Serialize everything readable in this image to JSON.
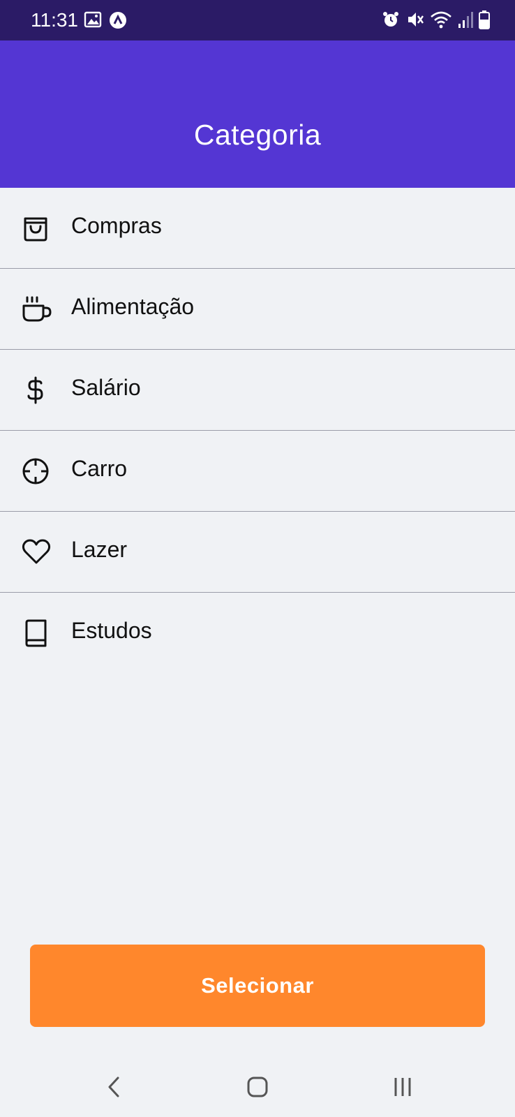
{
  "status_bar": {
    "time": "11:31",
    "left_icons": [
      "image-icon",
      "app-notification-icon"
    ],
    "right_icons": [
      "alarm-icon",
      "mute-icon",
      "wifi-icon",
      "signal-icon",
      "battery-icon"
    ]
  },
  "header": {
    "title": "Categoria",
    "background": "#5436D3"
  },
  "categories": [
    {
      "label": "Compras",
      "icon": "shopping-bag-icon"
    },
    {
      "label": "Alimentação",
      "icon": "coffee-icon"
    },
    {
      "label": "Salário",
      "icon": "dollar-sign-icon"
    },
    {
      "label": "Carro",
      "icon": "crosshair-icon"
    },
    {
      "label": "Lazer",
      "icon": "heart-icon"
    },
    {
      "label": "Estudos",
      "icon": "book-icon"
    }
  ],
  "select_button": {
    "label": "Selecionar",
    "color": "#FF872C"
  },
  "nav_bar": {
    "items": [
      "back-icon",
      "home-icon",
      "recents-icon"
    ]
  }
}
